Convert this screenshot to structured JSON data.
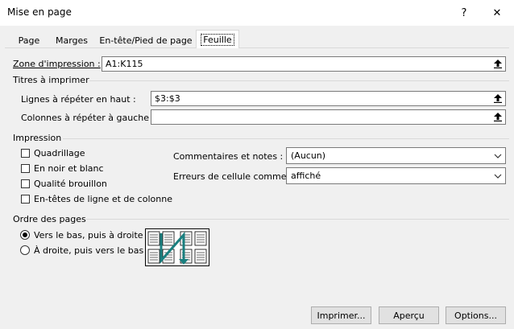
{
  "window": {
    "title": "Mise en page",
    "help_button": "?",
    "close_button": "✕"
  },
  "tabs": [
    {
      "label": "Page",
      "active": false
    },
    {
      "label": "Marges",
      "active": false
    },
    {
      "label": "En-tête/Pied de page",
      "active": false
    },
    {
      "label": "Feuille",
      "active": true
    }
  ],
  "print_area": {
    "label": "Zone d'impression :",
    "value": "A1:K115"
  },
  "print_titles": {
    "group_label": "Titres à imprimer",
    "rows_label": "Lignes à répéter en haut :",
    "rows_value": "$3:$3",
    "cols_label": "Colonnes à répéter à gauche :",
    "cols_value": ""
  },
  "print": {
    "group_label": "Impression",
    "options": [
      {
        "label": "Quadrillage",
        "checked": false
      },
      {
        "label": "En noir et blanc",
        "checked": false
      },
      {
        "label": "Qualité brouillon",
        "checked": false
      },
      {
        "label": "En-têtes de ligne et de colonne",
        "checked": false
      }
    ],
    "comments_label": "Commentaires et notes :",
    "comments_value": "(Aucun)",
    "errors_label": "Erreurs de cellule comme :",
    "errors_value": "affiché"
  },
  "page_order": {
    "group_label": "Ordre des pages",
    "options": [
      {
        "label": "Vers le bas, puis à droite",
        "selected": true
      },
      {
        "label": "À droite, puis vers le bas",
        "selected": false
      }
    ]
  },
  "buttons": {
    "print": "Imprimer...",
    "preview": "Aperçu",
    "options": "Options..."
  },
  "icons": {
    "collapse": "collapse-dialog-icon",
    "dropdown": "chevron-down-icon",
    "accent": "#1a7f7f"
  }
}
